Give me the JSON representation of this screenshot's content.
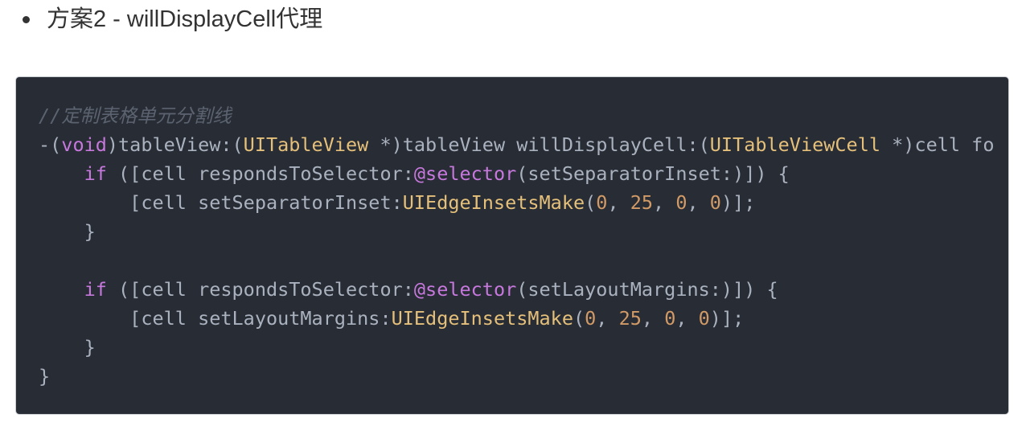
{
  "heading": {
    "text": "方案2 - willDisplayCell代理"
  },
  "code_block": {
    "lines": [
      [
        {
          "t": "comment",
          "v": "//定制表格单元分割线"
        }
      ],
      [
        {
          "t": "plain",
          "v": "-("
        },
        {
          "t": "keyword",
          "v": "void"
        },
        {
          "t": "plain",
          "v": ")tableView:("
        },
        {
          "t": "type",
          "v": "UITableView"
        },
        {
          "t": "plain",
          "v": " *)tableView willDisplayCell:("
        },
        {
          "t": "type",
          "v": "UITableViewCell"
        },
        {
          "t": "plain",
          "v": " *)cell fo"
        }
      ],
      [
        {
          "t": "plain",
          "v": "    "
        },
        {
          "t": "keyword",
          "v": "if"
        },
        {
          "t": "plain",
          "v": " ([cell respondsToSelector:"
        },
        {
          "t": "keyword",
          "v": "@selector"
        },
        {
          "t": "plain",
          "v": "(setSeparatorInset:)]) {"
        }
      ],
      [
        {
          "t": "plain",
          "v": "        [cell setSeparatorInset:"
        },
        {
          "t": "func",
          "v": "UIEdgeInsetsMake"
        },
        {
          "t": "plain",
          "v": "("
        },
        {
          "t": "number",
          "v": "0"
        },
        {
          "t": "plain",
          "v": ", "
        },
        {
          "t": "number",
          "v": "25"
        },
        {
          "t": "plain",
          "v": ", "
        },
        {
          "t": "number",
          "v": "0"
        },
        {
          "t": "plain",
          "v": ", "
        },
        {
          "t": "number",
          "v": "0"
        },
        {
          "t": "plain",
          "v": ")];"
        }
      ],
      [
        {
          "t": "plain",
          "v": "    }"
        }
      ],
      [],
      [
        {
          "t": "plain",
          "v": "    "
        },
        {
          "t": "keyword",
          "v": "if"
        },
        {
          "t": "plain",
          "v": " ([cell respondsToSelector:"
        },
        {
          "t": "keyword",
          "v": "@selector"
        },
        {
          "t": "plain",
          "v": "(setLayoutMargins:)]) {"
        }
      ],
      [
        {
          "t": "plain",
          "v": "        [cell setLayoutMargins:"
        },
        {
          "t": "func",
          "v": "UIEdgeInsetsMake"
        },
        {
          "t": "plain",
          "v": "("
        },
        {
          "t": "number",
          "v": "0"
        },
        {
          "t": "plain",
          "v": ", "
        },
        {
          "t": "number",
          "v": "25"
        },
        {
          "t": "plain",
          "v": ", "
        },
        {
          "t": "number",
          "v": "0"
        },
        {
          "t": "plain",
          "v": ", "
        },
        {
          "t": "number",
          "v": "0"
        },
        {
          "t": "plain",
          "v": ")];"
        }
      ],
      [
        {
          "t": "plain",
          "v": "    }"
        }
      ],
      [
        {
          "t": "plain",
          "v": "}"
        }
      ]
    ]
  },
  "colors": {
    "code_background": "#282c34",
    "comment": "#5c6370",
    "keyword": "#c678dd",
    "type": "#e5c07b",
    "number": "#d19a66",
    "plain": "#abb2bf",
    "body_text": "#333333"
  }
}
